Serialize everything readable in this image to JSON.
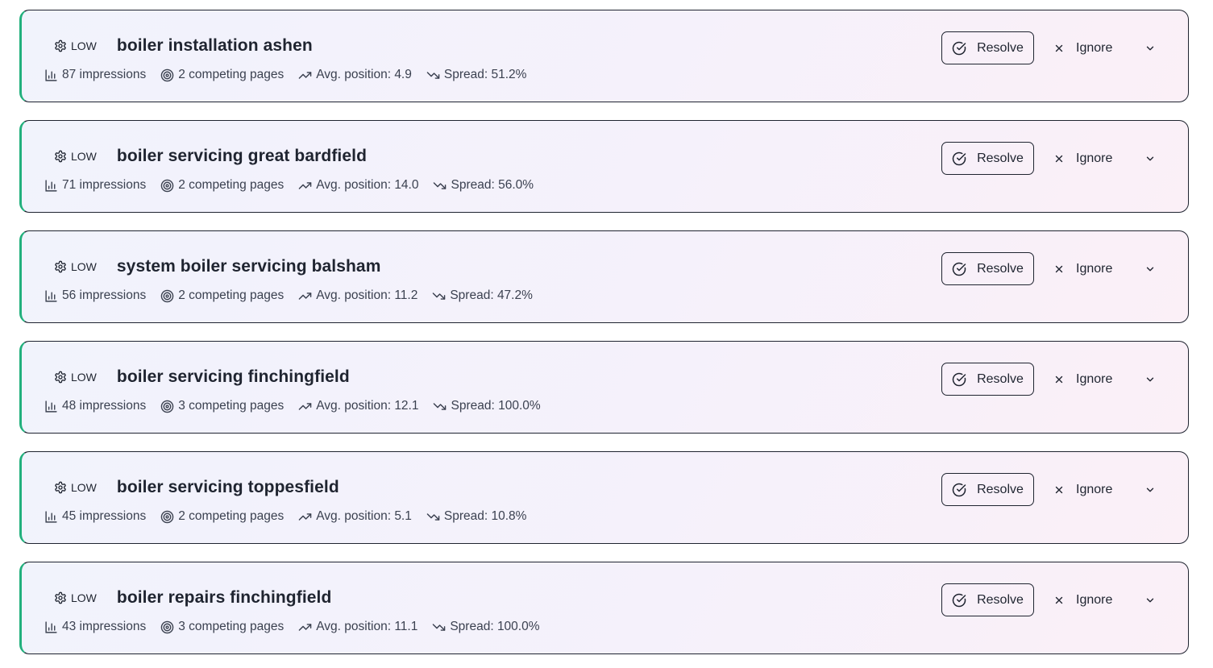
{
  "colors": {
    "accent_border": "#22b07d",
    "text": "#1f2430"
  },
  "items": [
    {
      "severity": "LOW",
      "keyword": "boiler installation ashen",
      "impressions": "87 impressions",
      "competing": "2 competing pages",
      "avg_position": "Avg. position: 4.9",
      "spread": "Spread: 51.2%",
      "spread_icon": "trending-down-icon",
      "resolve": "Resolve",
      "ignore": "Ignore"
    },
    {
      "severity": "LOW",
      "keyword": "boiler servicing great bardfield",
      "impressions": "71 impressions",
      "competing": "2 competing pages",
      "avg_position": "Avg. position: 14.0",
      "spread": "Spread: 56.0%",
      "spread_icon": "trending-down-icon",
      "resolve": "Resolve",
      "ignore": "Ignore"
    },
    {
      "severity": "LOW",
      "keyword": "system boiler servicing balsham",
      "impressions": "56 impressions",
      "competing": "2 competing pages",
      "avg_position": "Avg. position: 11.2",
      "spread": "Spread: 47.2%",
      "spread_icon": "trending-down-icon",
      "resolve": "Resolve",
      "ignore": "Ignore"
    },
    {
      "severity": "LOW",
      "keyword": "boiler servicing finchingfield",
      "impressions": "48 impressions",
      "competing": "3 competing pages",
      "avg_position": "Avg. position: 12.1",
      "spread": "Spread: 100.0%",
      "spread_icon": "trending-down-icon",
      "resolve": "Resolve",
      "ignore": "Ignore"
    },
    {
      "severity": "LOW",
      "keyword": "boiler servicing toppesfield",
      "impressions": "45 impressions",
      "competing": "2 competing pages",
      "avg_position": "Avg. position: 5.1",
      "spread": "Spread: 10.8%",
      "spread_icon": "trending-down-icon",
      "resolve": "Resolve",
      "ignore": "Ignore"
    },
    {
      "severity": "LOW",
      "keyword": "boiler repairs finchingfield",
      "impressions": "43 impressions",
      "competing": "3 competing pages",
      "avg_position": "Avg. position: 11.1",
      "spread": "Spread: 100.0%",
      "spread_icon": "trending-down-icon",
      "resolve": "Resolve",
      "ignore": "Ignore"
    }
  ]
}
